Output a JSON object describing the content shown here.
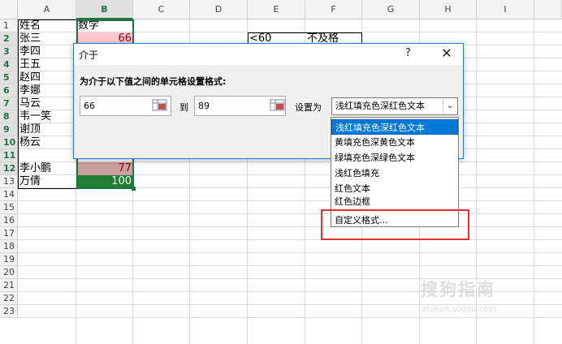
{
  "columns": [
    {
      "label": "A"
    },
    {
      "label": "B"
    },
    {
      "label": "C"
    },
    {
      "label": "D"
    },
    {
      "label": "E"
    },
    {
      "label": "F"
    },
    {
      "label": "G"
    },
    {
      "label": "H"
    },
    {
      "label": "I"
    }
  ],
  "rows": [
    "1",
    "2",
    "3",
    "4",
    "5",
    "6",
    "7",
    "8",
    "9",
    "10",
    "11",
    "12",
    "13",
    "14",
    "15",
    "16",
    "17",
    "18",
    "19",
    "20",
    "21",
    "22",
    "23"
  ],
  "cells": {
    "a1": "姓名",
    "b1": "数学",
    "a2": "张三",
    "b2": "66",
    "a3": "李四",
    "a4": "王五",
    "a5": "赵四",
    "a6": "李娜",
    "a7": "马云",
    "a8": "韦一笑",
    "a9": "谢顶",
    "a10": "杨云",
    "a11": "李小鹏",
    "b11": "77",
    "a12": "万倩",
    "b12": "100",
    "e2": "<60",
    "f2": "不及格"
  },
  "dialog": {
    "title": "介于",
    "help": "?",
    "close": "✕",
    "label": "为介于以下值之间的单元格设置格式:",
    "min_value": "66",
    "to_label": "到",
    "max_value": "89",
    "set_as_label": "设置为",
    "selected_format": "浅红填充色深红色文本"
  },
  "dropdown_options": [
    "浅红填充色深红色文本",
    "黄填充色深黄色文本",
    "绿填充色深绿色文本",
    "浅红色填充",
    "红色文本",
    "红色边框",
    "自定义格式..."
  ],
  "watermark": {
    "text": "搜狗指南",
    "sub": "zhinan.sogou.com"
  },
  "colors": {
    "accent": "#217346",
    "cell_pink": "#ffc7ce",
    "cell_rose": "#c9a0a0",
    "cell_green": "#1e7d32",
    "highlight": "#0078d7",
    "red_box": "#e53030"
  }
}
